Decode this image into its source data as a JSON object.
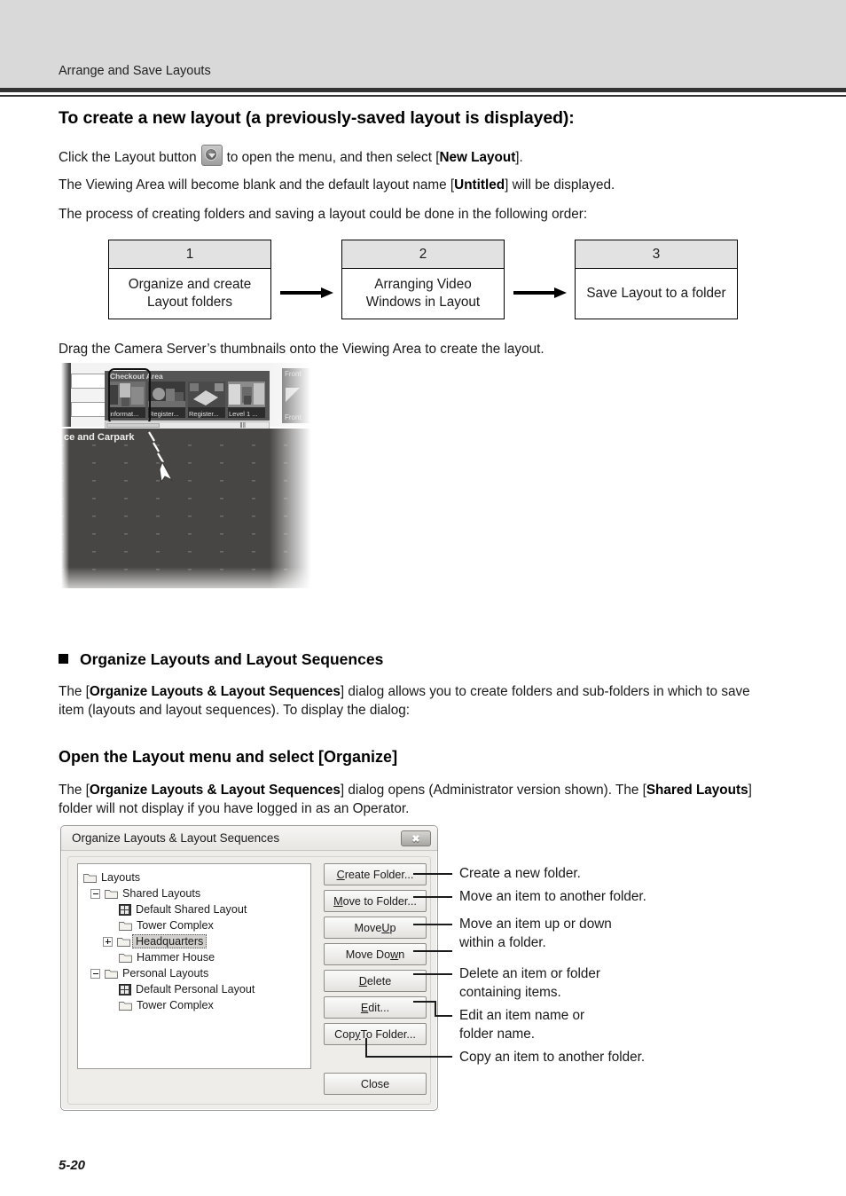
{
  "header": {
    "running_head": "Arrange and Save Layouts"
  },
  "sections": {
    "create_layout": {
      "heading": "To create a new layout (a previously-saved layout is displayed):",
      "p1_a": "Click the Layout button",
      "p1_b": "to open the menu, and then select [",
      "p1_bold": "New Layout",
      "p1_c": "].",
      "p2_a": "The Viewing Area will become blank and the default layout name [",
      "p2_bold": "Untitled",
      "p2_b": "] will be displayed.",
      "p3": "The process of creating folders and saving a layout could be done in the following order:",
      "p4": "Drag the Camera Server’s thumbnails onto the Viewing Area to create the layout."
    },
    "organize": {
      "bullet_heading": "Organize Layouts and Layout Sequences",
      "p1_a": "The [",
      "p1_bold": "Organize Layouts & Layout Sequences",
      "p1_b": "] dialog allows you to create folders and sub-folders in which to save item (layouts and layout sequences). To display the dialog:",
      "sub_heading": "Open the Layout menu and select [Organize]",
      "p2_a": "The [",
      "p2_bold1": "Organize Layouts & Layout Sequences",
      "p2_b": "] dialog opens (Administrator version shown). The [",
      "p2_bold2": "Shared Layouts",
      "p2_c": "] folder will not display if you have logged in as an Operator."
    }
  },
  "flow": {
    "steps": [
      {
        "number": "1",
        "label": "Organize and create\nLayout folders"
      },
      {
        "number": "2",
        "label": "Arranging Video\nWindows in Layout"
      },
      {
        "number": "3",
        "label": "Save Layout to a\nfolder"
      }
    ]
  },
  "screenshot": {
    "thumbstrip_title": "Checkout Area",
    "thumbnails": [
      {
        "caption": "informat..."
      },
      {
        "caption": "Register..."
      },
      {
        "caption": "Register..."
      },
      {
        "caption": "Level 1 ..."
      }
    ],
    "right_panel_top": "Front",
    "right_panel_bottom": "Front",
    "viewing_area_title": "ce and Carpark",
    "scrollbar_marker": "‖‖"
  },
  "dialog": {
    "title": "Organize Layouts & Layout Sequences",
    "close_label": "✖",
    "tree": [
      {
        "label": "Layouts",
        "indent": 0,
        "icon": "folder",
        "expander": "none",
        "selected": false
      },
      {
        "label": "Shared Layouts",
        "indent": 1,
        "icon": "folder",
        "expander": "minus",
        "selected": false
      },
      {
        "label": "Default Shared Layout",
        "indent": 2,
        "icon": "grid",
        "expander": "none",
        "selected": false
      },
      {
        "label": "Tower Complex",
        "indent": 2,
        "icon": "folder",
        "expander": "none",
        "selected": false
      },
      {
        "label": "Headquarters",
        "indent": 1,
        "icon": "folder",
        "expander": "plus",
        "selected": true
      },
      {
        "label": "Hammer House",
        "indent": 2,
        "icon": "folder",
        "expander": "none",
        "selected": false
      },
      {
        "label": "Personal Layouts",
        "indent": 1,
        "icon": "folder",
        "expander": "minus",
        "selected": false
      },
      {
        "label": "Default Personal Layout",
        "indent": 2,
        "icon": "grid",
        "expander": "none",
        "selected": false
      },
      {
        "label": "Tower Complex",
        "indent": 2,
        "icon": "folder",
        "expander": "none",
        "selected": false
      }
    ],
    "buttons": [
      {
        "pre": "",
        "key": "C",
        "post": "reate Folder..."
      },
      {
        "pre": "",
        "key": "M",
        "post": "ove to Folder..."
      },
      {
        "pre": "Move ",
        "key": "U",
        "post": "p"
      },
      {
        "pre": "Move Do",
        "key": "w",
        "post": "n"
      },
      {
        "pre": "",
        "key": "D",
        "post": "elete"
      },
      {
        "pre": "",
        "key": "E",
        "post": "dit..."
      },
      {
        "pre": "Cop",
        "key": "y",
        "post": " To Folder..."
      }
    ],
    "close_button": "Close"
  },
  "annotations": [
    "Create a new folder.",
    "Move an item to another folder.",
    "Move an item up or down\nwithin a folder.",
    "Delete an item or folder\ncontaining items.",
    "Edit an item name or\nfolder name.",
    "Copy an item to another folder."
  ],
  "footer": {
    "page_number": "5-20"
  }
}
